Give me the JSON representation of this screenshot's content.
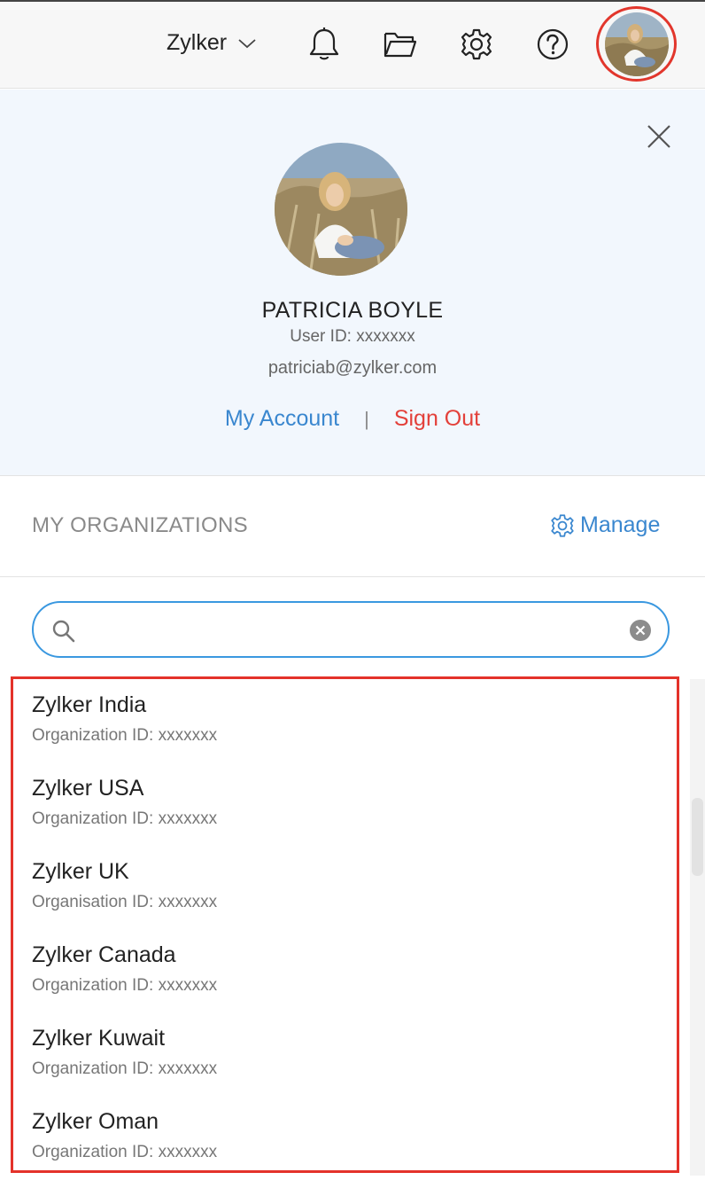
{
  "topbar": {
    "org_name": "Zylker",
    "icons": [
      "bell-icon",
      "folder-icon",
      "gear-icon",
      "help-icon"
    ],
    "accent_color": "#e2362c"
  },
  "profile": {
    "name": "PATRICIA BOYLE",
    "user_id": "User ID: xxxxxxx",
    "email": "patriciab@zylker.com",
    "my_account": "My Account",
    "separator": "|",
    "sign_out": "Sign Out",
    "colors": {
      "link": "#3a87cf",
      "sign_out": "#e3403a",
      "background": "#f2f7fd"
    }
  },
  "organizations": {
    "title": "MY ORGANIZATIONS",
    "manage_label": "Manage",
    "search": {
      "value": "",
      "placeholder": ""
    },
    "items": [
      {
        "name": "Zylker India",
        "id": "Organization ID: xxxxxxx"
      },
      {
        "name": "Zylker USA",
        "id": "Organization ID: xxxxxxx"
      },
      {
        "name": "Zylker UK",
        "id": "Organisation ID: xxxxxxx"
      },
      {
        "name": "Zylker Canada",
        "id": "Organization ID: xxxxxxx"
      },
      {
        "name": "Zylker Kuwait",
        "id": "Organization ID: xxxxxxx"
      },
      {
        "name": "Zylker Oman",
        "id": "Organization ID: xxxxxxx"
      }
    ]
  }
}
